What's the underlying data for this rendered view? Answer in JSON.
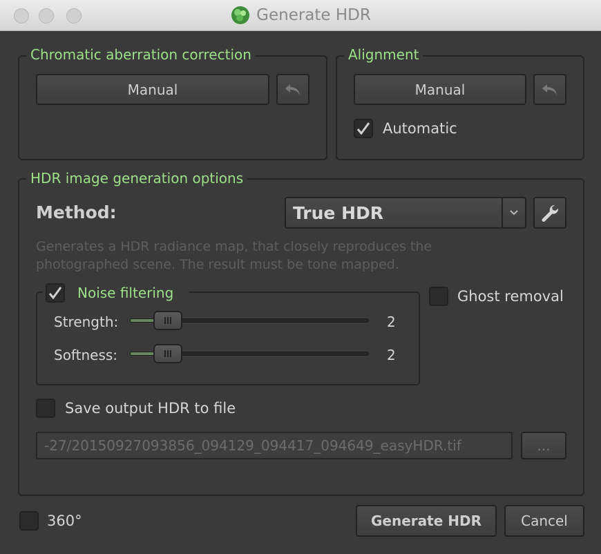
{
  "window": {
    "title": "Generate HDR"
  },
  "chromatic": {
    "title": "Chromatic aberration correction",
    "manual_label": "Manual"
  },
  "alignment": {
    "title": "Alignment",
    "manual_label": "Manual",
    "automatic_label": "Automatic",
    "automatic_checked": true
  },
  "hdr_options": {
    "title": "HDR image generation options",
    "method_label": "Method:",
    "method_value": "True HDR",
    "description_line1": "Generates a HDR radiance map, that closely reproduces the",
    "description_line2": "photographed scene. The result must be tone mapped.",
    "noise": {
      "label": "Noise filtering",
      "checked": true,
      "strength_label": "Strength:",
      "strength_value": "2",
      "softness_label": "Softness:",
      "softness_value": "2"
    },
    "ghost_label": "Ghost removal",
    "ghost_checked": false,
    "save_label": "Save output HDR to file",
    "save_checked": false,
    "output_path": "-27/20150927093856_094129_094417_094649_easyHDR.tif",
    "browse_label": "..."
  },
  "footer": {
    "pano_label": "360°",
    "pano_checked": false,
    "generate_label": "Generate HDR",
    "cancel_label": "Cancel"
  },
  "colors": {
    "accent_green": "#9ee08a",
    "background": "#3a3a3a"
  }
}
